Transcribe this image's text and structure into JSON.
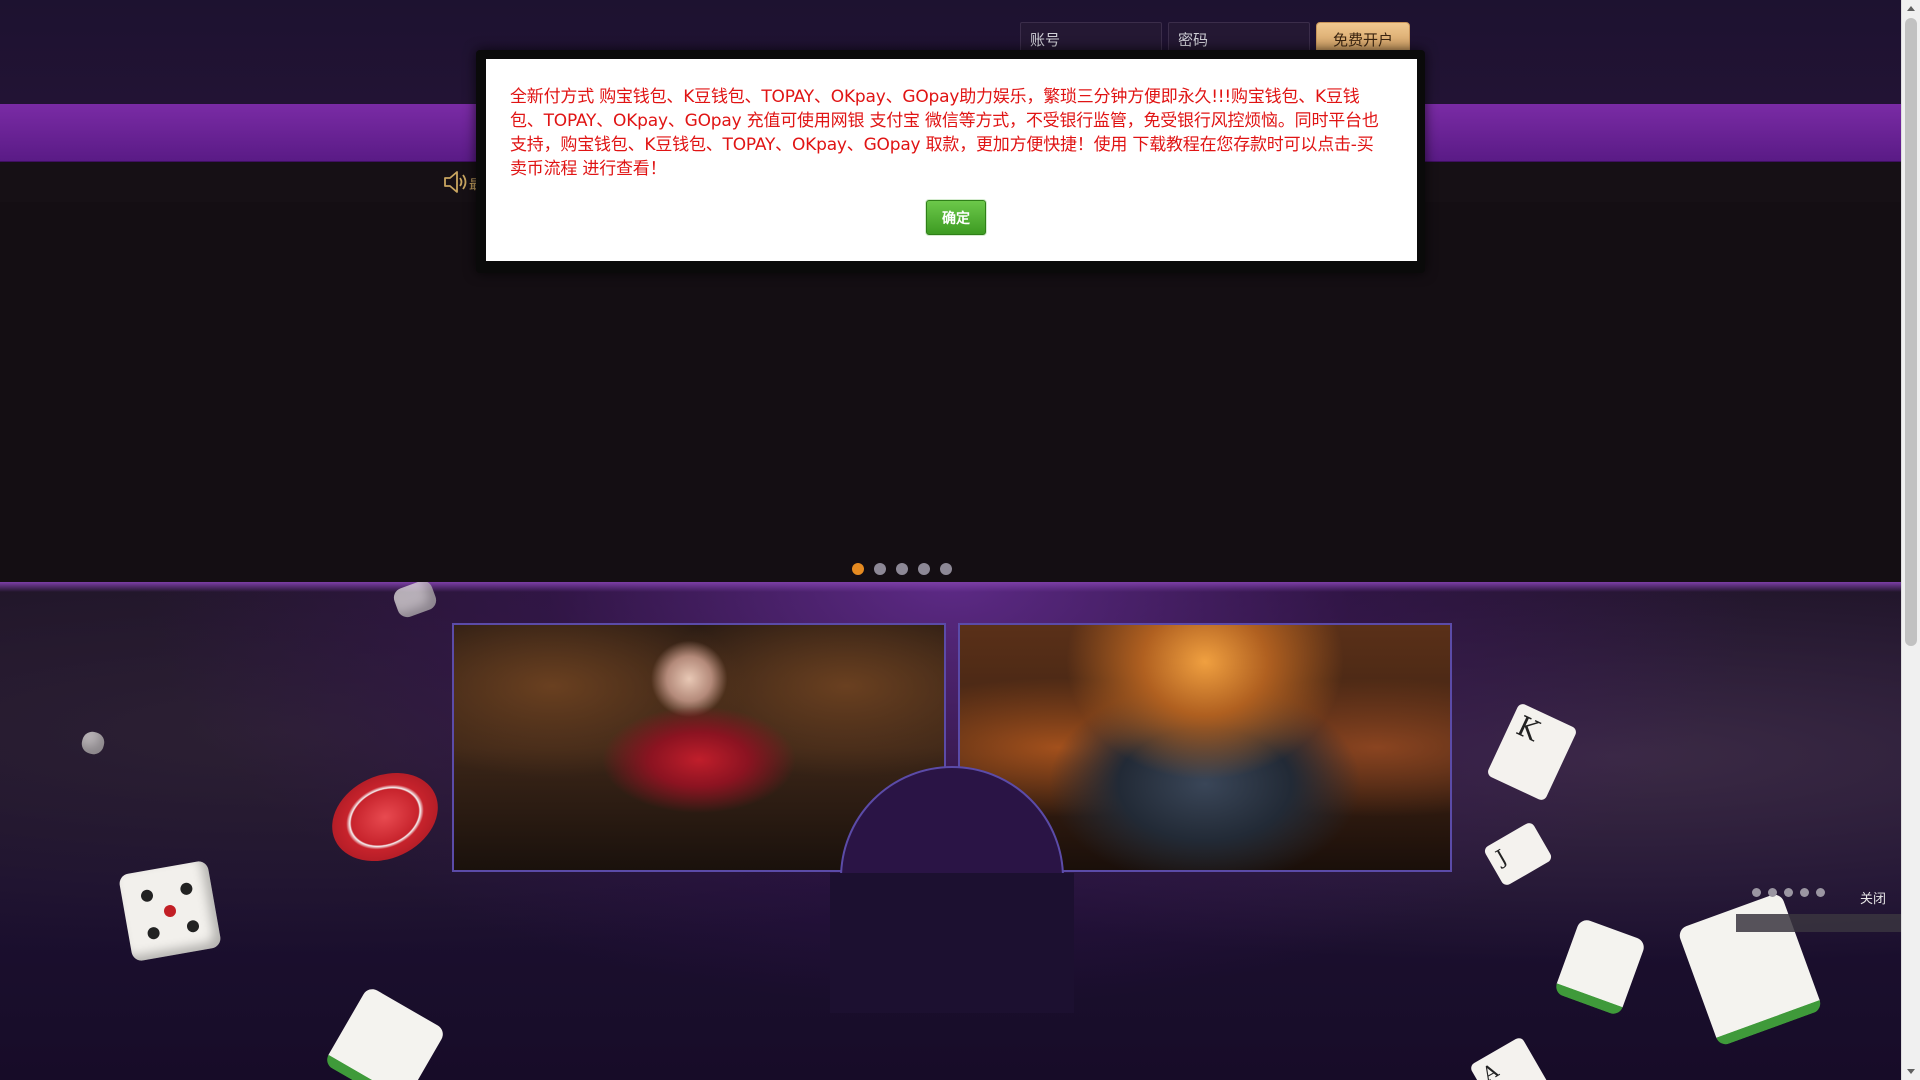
{
  "header": {
    "account_placeholder": "账号",
    "password_placeholder": "密码",
    "register_label": "免费开户"
  },
  "notice": {
    "icon": "speaker-icon",
    "text": "最"
  },
  "banner": {
    "dots": 5,
    "active_dot": 1
  },
  "side_panel": {
    "close_label": "关闭"
  },
  "modal": {
    "message": "全新付方式 购宝钱包、K豆钱包、TOPAY、OKpay、GOpay助力娱乐，繁琐三分钟方便即永久!!!购宝钱包、K豆钱包、TOPAY、OKpay、GOpay 充值可使用网银 支付宝 微信等方式，不受银行监管，免受银行风控烦恼。同时平台也支持，购宝钱包、K豆钱包、TOPAY、OKpay、GOpay 取款，更加方便快捷！使用 下载教程在您存款时可以点击-买卖币流程 进行查看！",
    "confirm_label": "确定"
  },
  "colors": {
    "modal_text": "#e01414",
    "confirm_button": "#4caf2a",
    "nav_purple": "#6a239a",
    "active_dot": "#e58a21"
  }
}
